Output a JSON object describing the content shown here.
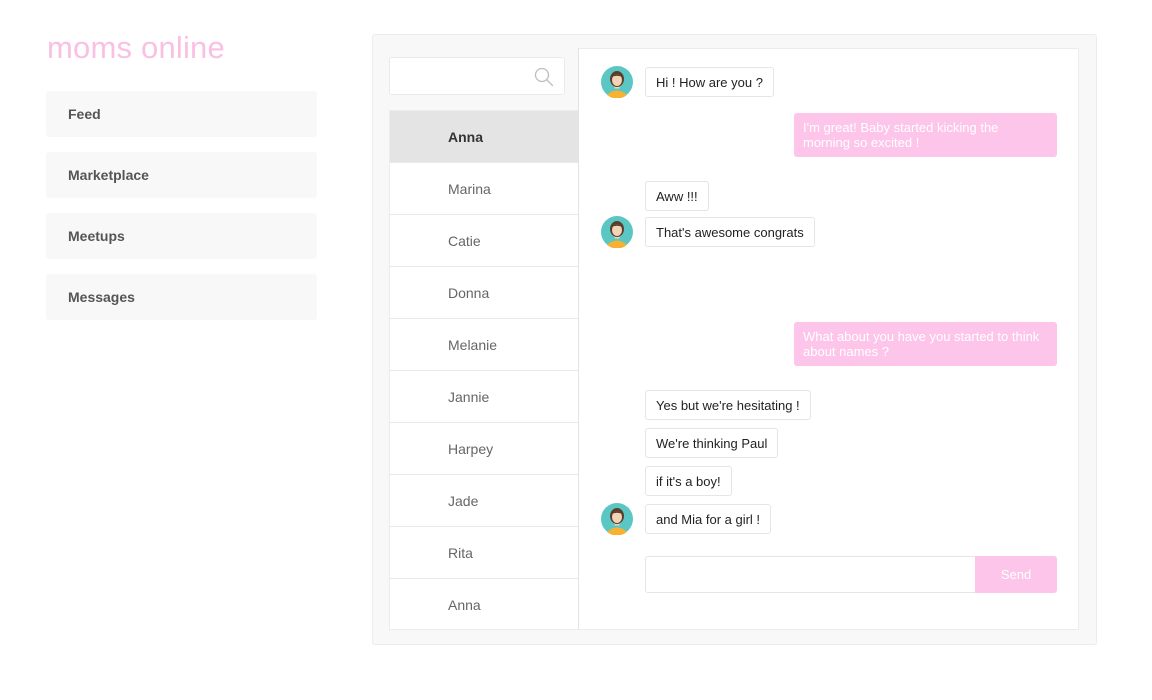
{
  "app": {
    "brand": "moms online",
    "brand_color": "#fac0e4",
    "accent_color": "#fcc5e9"
  },
  "nav": {
    "items": [
      {
        "label": "Feed"
      },
      {
        "label": "Marketplace"
      },
      {
        "label": "Meetups"
      },
      {
        "label": "Messages"
      }
    ]
  },
  "search": {
    "placeholder": "",
    "value": "",
    "icon": "search-icon"
  },
  "contacts": [
    {
      "name": "Anna",
      "active": true
    },
    {
      "name": "Marina"
    },
    {
      "name": "Catie"
    },
    {
      "name": "Donna"
    },
    {
      "name": "Melanie"
    },
    {
      "name": "Jannie"
    },
    {
      "name": "Harpey"
    },
    {
      "name": "Jade"
    },
    {
      "name": "Rita"
    },
    {
      "name": "Anna"
    }
  ],
  "messages": [
    {
      "from": "them",
      "text": "Hi ! How are you ?"
    },
    {
      "from": "me",
      "text": "I'm great! Baby started kicking the morning so excited !"
    },
    {
      "from": "them",
      "text": "Aww !!!"
    },
    {
      "from": "them",
      "text": "That's awesome congrats"
    },
    {
      "from": "me",
      "text": "What about you have you started to think about names ?"
    },
    {
      "from": "them",
      "text": "Yes but we're hesitating !"
    },
    {
      "from": "them",
      "text": "We're thinking Paul"
    },
    {
      "from": "them",
      "text": "if it's a boy!"
    },
    {
      "from": "them",
      "text": "and Mia for a girl !"
    }
  ],
  "composer": {
    "value": "",
    "placeholder": "",
    "send_label": "Send"
  }
}
